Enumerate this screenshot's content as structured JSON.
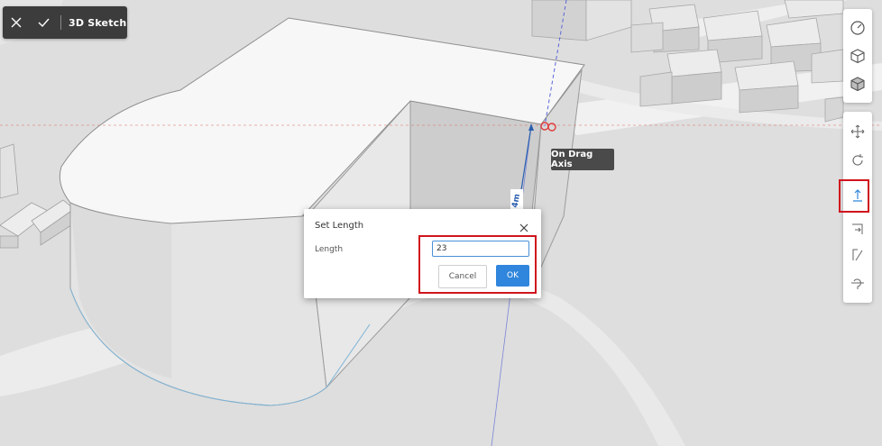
{
  "toolbar": {
    "title": "3D Sketch",
    "icons": [
      "close-icon",
      "check-icon"
    ]
  },
  "right_panel": {
    "view_tools": [
      "compass-icon",
      "cube-outline-icon",
      "cube-shaded-icon"
    ],
    "edit_tools": [
      "move-icon",
      "rotate-icon",
      "push-pull-icon",
      "offset-icon",
      "draw-line-icon",
      "reset-icon"
    ],
    "active_tool": "push-pull-icon"
  },
  "tooltip": {
    "text": "On Drag Axis"
  },
  "dimension": {
    "text": "4m"
  },
  "dialog": {
    "title": "Set Length",
    "length_label": "Length",
    "length_value": "23",
    "cancel_label": "Cancel",
    "ok_label": "OK"
  },
  "colors": {
    "highlight": "#d0141d",
    "accent": "#2f86dc",
    "toolbar_bg": "#3c3c3c"
  }
}
